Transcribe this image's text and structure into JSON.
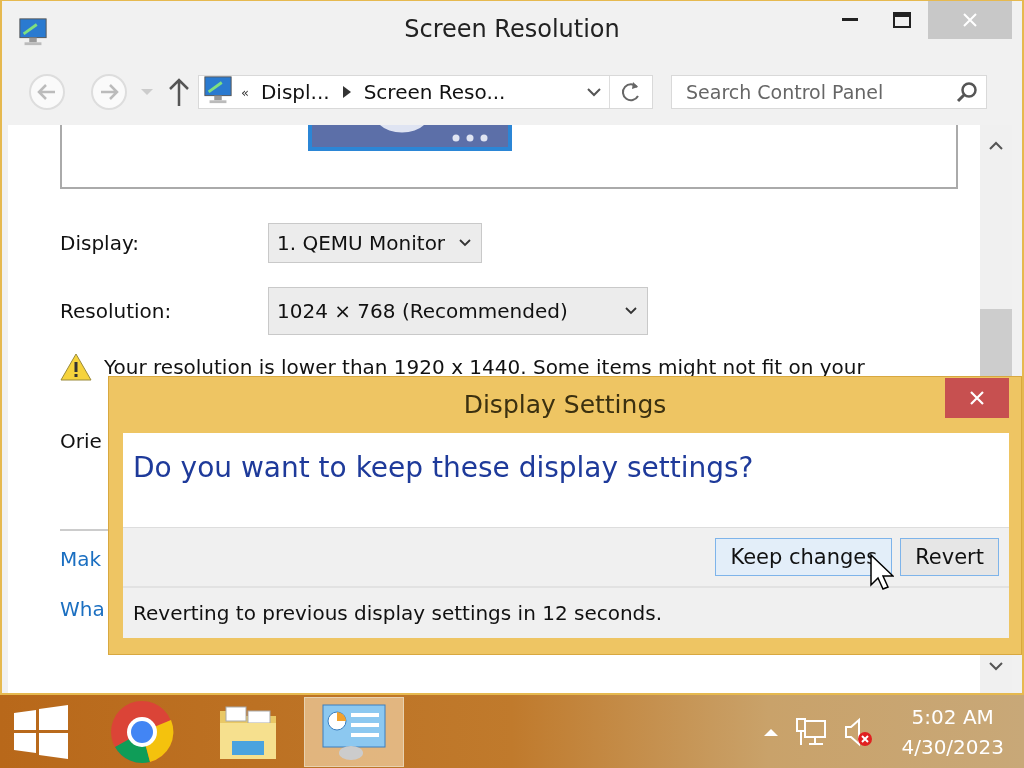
{
  "window": {
    "title": "Screen Resolution"
  },
  "address_bar": {
    "prefix": "«",
    "crumbs": [
      "Displ...",
      "Screen Reso..."
    ]
  },
  "search": {
    "placeholder": "Search Control Panel"
  },
  "settings": [
    {
      "label": "Display:",
      "value": "1. QEMU Monitor"
    },
    {
      "label": "Resolution:",
      "value": "1024 × 768 (Recommended)"
    }
  ],
  "warning": {
    "text": "Your resolution is lower than 1920 x 1440. Some items might not fit on your"
  },
  "orientation_label": "Orie",
  "links": [
    "Mak",
    "Wha"
  ],
  "dialog": {
    "title": "Display Settings",
    "question": "Do you want to keep these display settings?",
    "buttons": [
      {
        "label": "Keep changes",
        "hovered": true
      },
      {
        "label": "Revert",
        "hovered": false
      }
    ],
    "footer": "Reverting to previous display settings in 12 seconds."
  },
  "taskbar": {
    "apps": [
      {
        "kind": "browser",
        "selected": false
      },
      {
        "kind": "folder",
        "selected": false
      },
      {
        "kind": "control-panel",
        "selected": true
      }
    ],
    "time": "5:02 AM",
    "date": "4/30/2023"
  }
}
